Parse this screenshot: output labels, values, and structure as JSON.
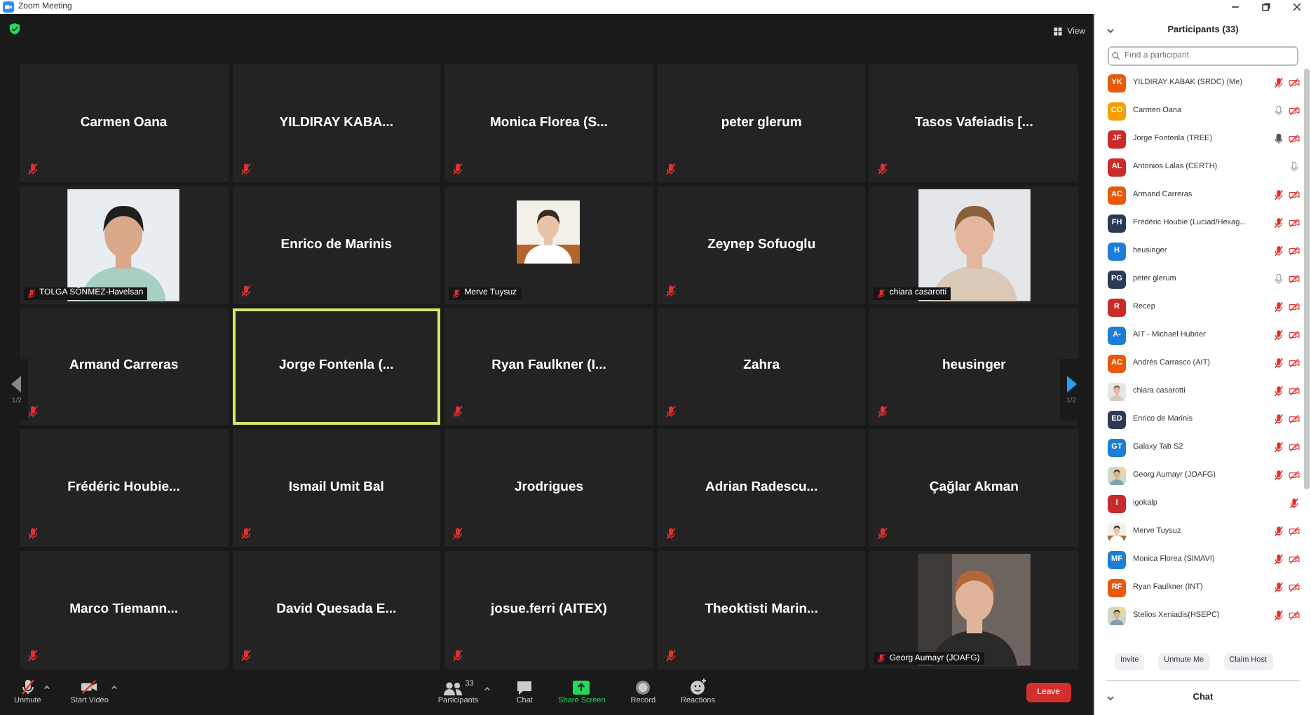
{
  "window": {
    "title": "Zoom Meeting"
  },
  "top_bar": {
    "view": "View"
  },
  "pager": {
    "left": "1/2",
    "right": "1/2"
  },
  "tiles": [
    {
      "kind": "name",
      "name": "Carmen Oana",
      "muted": true,
      "speaking": false
    },
    {
      "kind": "name",
      "name": "YILDIRAY KABA...",
      "muted": true,
      "speaking": false
    },
    {
      "kind": "name",
      "name": "Monica Florea (S...",
      "muted": true,
      "speaking": false
    },
    {
      "kind": "name",
      "name": "peter glerum",
      "muted": true,
      "speaking": false
    },
    {
      "kind": "name",
      "name": "Tasos Vafeiadis [...",
      "muted": true,
      "speaking": false
    },
    {
      "kind": "video",
      "name": "TOLGA SÖNMEZ-Havelsan",
      "small_picture": false,
      "muted": true,
      "speaking": false
    },
    {
      "kind": "name",
      "name": "Enrico de Marinis",
      "muted": true,
      "speaking": false
    },
    {
      "kind": "video",
      "name": "Merve Tuysuz",
      "small_picture": true,
      "muted": true,
      "speaking": false
    },
    {
      "kind": "name",
      "name": "Zeynep Sofuoglu",
      "muted": true,
      "speaking": false
    },
    {
      "kind": "video",
      "name": "chiara casarotti",
      "small_picture": false,
      "muted": true,
      "speaking": false
    },
    {
      "kind": "name",
      "name": "Armand Carreras",
      "muted": true,
      "speaking": false
    },
    {
      "kind": "name",
      "name": "Jorge Fontenla (...",
      "muted": false,
      "speaking": true
    },
    {
      "kind": "name",
      "name": "Ryan Faulkner (I...",
      "muted": true,
      "speaking": false
    },
    {
      "kind": "name",
      "name": "Zahra",
      "muted": true,
      "speaking": false
    },
    {
      "kind": "name",
      "name": "heusinger",
      "muted": true,
      "speaking": false
    },
    {
      "kind": "name",
      "name": "Frédéric Houbie...",
      "muted": true,
      "speaking": false
    },
    {
      "kind": "name",
      "name": "Ismail Umit Bal",
      "muted": true,
      "speaking": false
    },
    {
      "kind": "name",
      "name": "Jrodrigues",
      "muted": true,
      "speaking": false
    },
    {
      "kind": "name",
      "name": "Adrian Radescu...",
      "muted": true,
      "speaking": false
    },
    {
      "kind": "name",
      "name": "Çağlar Akman",
      "muted": true,
      "speaking": false
    },
    {
      "kind": "name",
      "name": "Marco Tiemann...",
      "muted": true,
      "speaking": false
    },
    {
      "kind": "name",
      "name": "David Quesada E...",
      "muted": true,
      "speaking": false
    },
    {
      "kind": "name",
      "name": "josue.ferri (AITEX)",
      "muted": true,
      "speaking": false
    },
    {
      "kind": "name",
      "name": "Theoktisti Marin...",
      "muted": true,
      "speaking": false
    },
    {
      "kind": "video",
      "name": "Georg Aumayr (JOAFG)",
      "small_picture": false,
      "muted": true,
      "speaking": false
    }
  ],
  "toolbar": {
    "unmute": "Unmute",
    "start_video": "Start Video",
    "participants": "Participants",
    "participant_count": "33",
    "chat": "Chat",
    "share_screen": "Share Screen",
    "record": "Record",
    "reactions": "Reactions",
    "leave": "Leave"
  },
  "participants_panel": {
    "title": "Participants (33)",
    "search": {
      "placeholder": "Find a participant"
    },
    "participants": [
      {
        "kind": "initials",
        "initials": "YK",
        "color": "#e8590c",
        "name": "YILDIRAY KABAK (SRDC) (Me)",
        "mic_muted": true,
        "talking": false,
        "video_off": true
      },
      {
        "kind": "initials",
        "initials": "CO",
        "color": "#f59f00",
        "name": "Carmen Oana",
        "mic_muted": false,
        "talking": false,
        "video_off": true
      },
      {
        "kind": "initials",
        "initials": "JF",
        "color": "#c92a2a",
        "name": "Jorge Fontenla (TREE)",
        "mic_muted": false,
        "talking": true,
        "video_off": true
      },
      {
        "kind": "initials",
        "initials": "AL",
        "color": "#c92a2a",
        "name": "Antonios Lalas (CERTH)",
        "mic_muted": false,
        "talking": false,
        "video_off": false
      },
      {
        "kind": "initials",
        "initials": "AC",
        "color": "#e8590c",
        "name": "Armand Carreras",
        "mic_muted": true,
        "talking": false,
        "video_off": true
      },
      {
        "kind": "initials",
        "initials": "FH",
        "color": "#2b3a55",
        "name": "Frédéric Houbie (Luciad/Hexag...",
        "mic_muted": true,
        "talking": false,
        "video_off": true
      },
      {
        "kind": "initials",
        "initials": "H",
        "color": "#1c7ed6",
        "name": "heusinger",
        "mic_muted": true,
        "talking": false,
        "video_off": true
      },
      {
        "kind": "initials",
        "initials": "PG",
        "color": "#2b3a55",
        "name": "peter glerum",
        "mic_muted": false,
        "talking": false,
        "video_off": true
      },
      {
        "kind": "initials",
        "initials": "R",
        "color": "#c92a2a",
        "name": "Recep",
        "mic_muted": true,
        "talking": false,
        "video_off": true
      },
      {
        "kind": "initials",
        "initials": "A-",
        "color": "#1c7ed6",
        "name": "AIT - Michael Hubner",
        "mic_muted": true,
        "talking": false,
        "video_off": true
      },
      {
        "kind": "initials",
        "initials": "AC",
        "color": "#e8590c",
        "name": "Andrés Carrasco (AIT)",
        "mic_muted": true,
        "talking": false,
        "video_off": true
      },
      {
        "kind": "picture",
        "name": "chiara casarotti",
        "mic_muted": true,
        "talking": false,
        "video_off": true
      },
      {
        "kind": "initials",
        "initials": "ED",
        "color": "#2b3a55",
        "name": "Enrico de Marinis",
        "mic_muted": true,
        "talking": false,
        "video_off": true
      },
      {
        "kind": "initials",
        "initials": "GT",
        "color": "#1c7ed6",
        "name": "Galaxy Tab S2",
        "mic_muted": true,
        "talking": false,
        "video_off": true
      },
      {
        "kind": "picture",
        "name": "Georg Aumayr (JOAFG)",
        "mic_muted": true,
        "talking": false,
        "video_off": true
      },
      {
        "kind": "initials",
        "initials": "I",
        "color": "#c92a2a",
        "name": "igokalp",
        "mic_muted": true,
        "talking": false,
        "video_off": false
      },
      {
        "kind": "picture",
        "name": "Merve Tuysuz",
        "mic_muted": true,
        "talking": false,
        "video_off": true
      },
      {
        "kind": "initials",
        "initials": "MF",
        "color": "#1c7ed6",
        "name": "Monica Florea (SIMAVI)",
        "mic_muted": true,
        "talking": false,
        "video_off": true
      },
      {
        "kind": "initials",
        "initials": "RF",
        "color": "#e8590c",
        "name": "Ryan Faulkner (INT)",
        "mic_muted": true,
        "talking": false,
        "video_off": true
      },
      {
        "kind": "picture",
        "name": "Stelios Xeniadis(HSEPC)",
        "mic_muted": true,
        "talking": false,
        "video_off": true
      }
    ],
    "buttons": [
      "Invite",
      "Unmute Me",
      "Claim Host"
    ]
  },
  "chat_panel": {
    "title": "Chat"
  }
}
